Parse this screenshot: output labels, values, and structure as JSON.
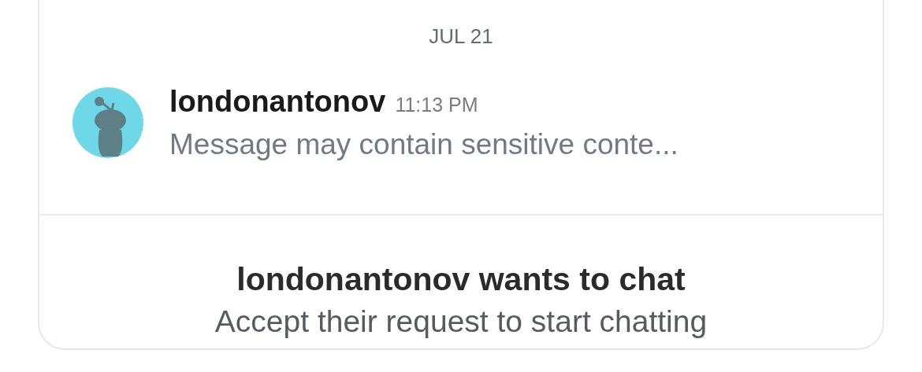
{
  "date": "JUL 21",
  "message": {
    "username": "londonantonov",
    "time": "11:13 PM",
    "preview": "Message may contain sensitive conte..."
  },
  "request": {
    "title": "londonantonov wants to chat",
    "subtitle": "Accept their request to start chatting"
  }
}
